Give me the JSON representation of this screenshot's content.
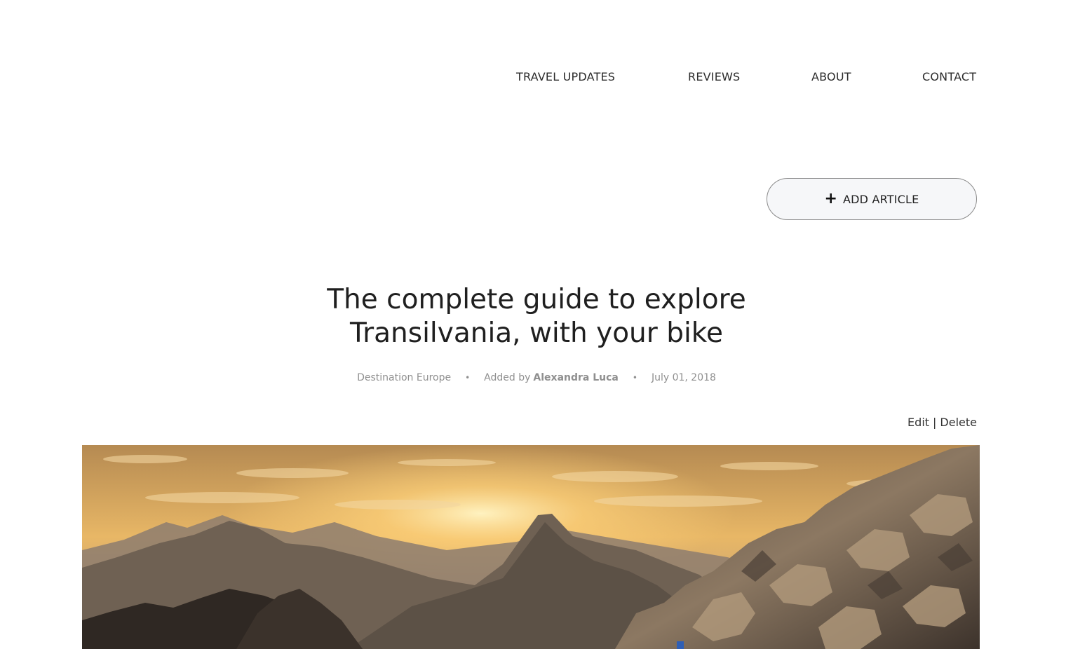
{
  "nav": {
    "items": [
      {
        "label": "TRAVEL UPDATES"
      },
      {
        "label": "REVIEWS"
      },
      {
        "label": "ABOUT"
      },
      {
        "label": "CONTACT"
      }
    ]
  },
  "add_article": {
    "icon": "plus-icon",
    "label": "ADD ARTICLE"
  },
  "article": {
    "title_line1": "The complete guide to explore",
    "title_line2": "Transilvania, with your bike",
    "category": "Destination Europe",
    "added_by_prefix": "Added by",
    "author": "Alexandra Luca",
    "date": "July 01, 2018",
    "meta_separator": "•"
  },
  "actions": {
    "edit": "Edit",
    "separator": "|",
    "delete": "Delete"
  },
  "hero": {
    "icon": "mountain-sunset-photo"
  },
  "colors": {
    "sky_top": "#c99a5a",
    "sun": "#ffd98a",
    "mountain_far": "#7a6b5e",
    "mountain_near": "#3a322b",
    "rock": "#8a7660"
  }
}
